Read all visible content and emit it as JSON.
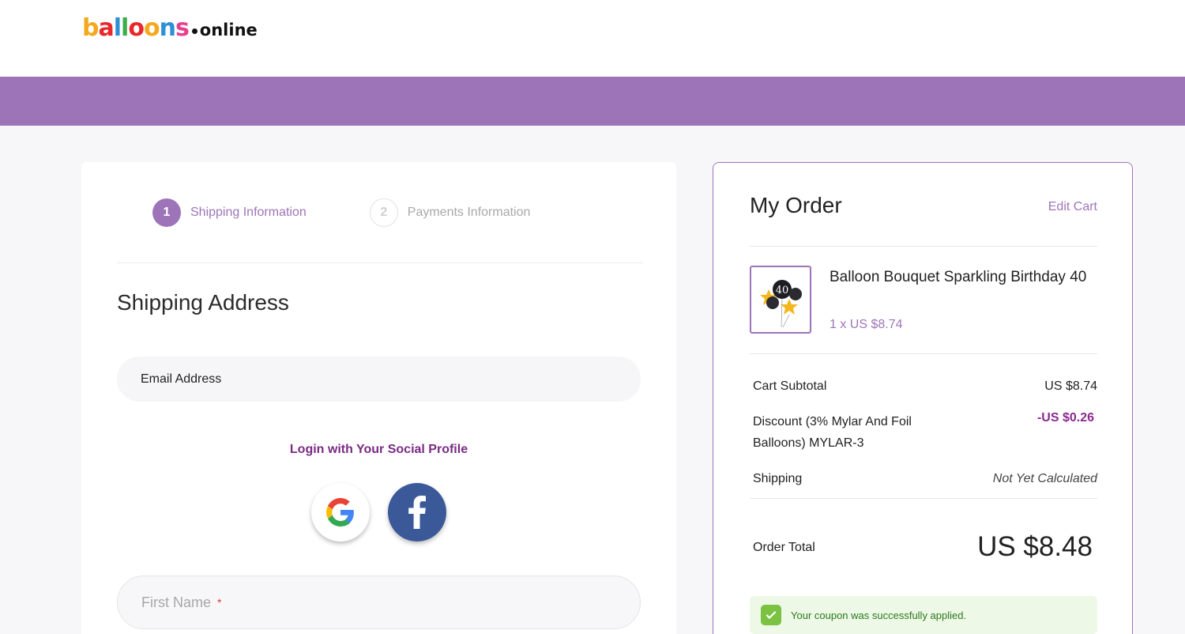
{
  "header": {
    "logo_balloons": "balloons",
    "logo_online": "online"
  },
  "checkout": {
    "steps": [
      {
        "number": "1",
        "label": "Shipping Information"
      },
      {
        "number": "2",
        "label": "Payments Information"
      }
    ],
    "section_title": "Shipping Address",
    "email_placeholder": "Email Address",
    "social_title": "Login with Your Social Profile",
    "first_name_placeholder": "First Name",
    "required_mark": "*"
  },
  "order": {
    "title": "My Order",
    "edit_cart": "Edit Cart",
    "item": {
      "name": "Balloon Bouquet Sparkling Birthday 40",
      "qty_price": "1 x US $8.74",
      "thumb_label": "40"
    },
    "subtotal_label": "Cart Subtotal",
    "subtotal_value": "US $8.74",
    "discount_label": "Discount (3% Mylar And Foil Balloons) MYLAR-3",
    "discount_value": "-US $0.26",
    "shipping_label": "Shipping",
    "shipping_value": "Not Yet Calculated",
    "total_label": "Order Total",
    "total_value": "US $8.48",
    "coupon_message": "Your coupon was successfully applied."
  },
  "colors": {
    "brand_purple": "#9e74b9",
    "link_purple": "#7a2a84",
    "success_green": "#7cc242",
    "facebook_blue": "#3b5998"
  }
}
